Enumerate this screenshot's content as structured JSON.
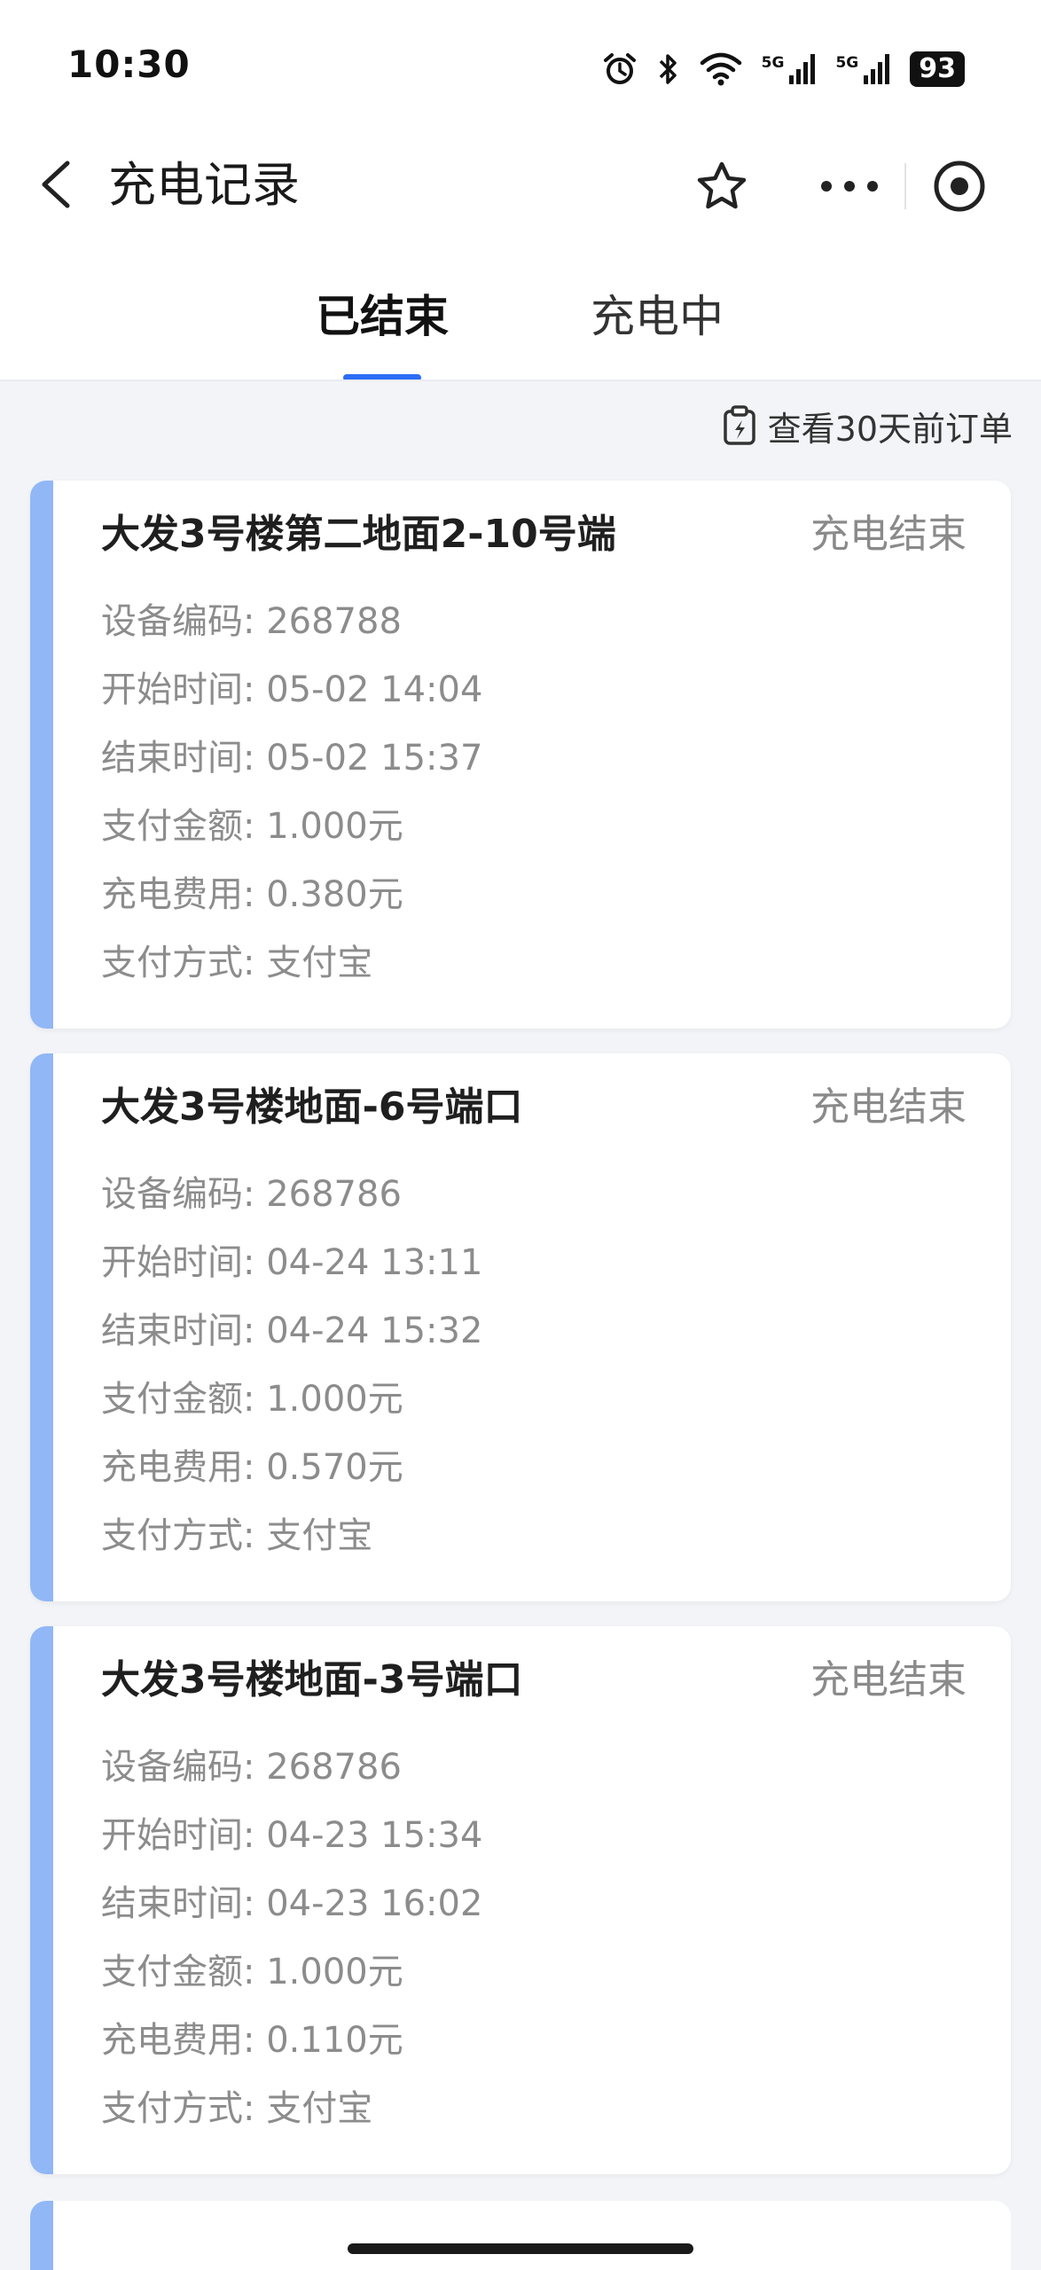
{
  "status_bar": {
    "time": "10:30",
    "signal_label_1": "5G",
    "signal_label_2": "5G",
    "battery": "93"
  },
  "nav": {
    "title": "充电记录"
  },
  "tabs": [
    {
      "label": "已结束",
      "active": true
    },
    {
      "label": "充电中",
      "active": false
    }
  ],
  "history_link": {
    "label": "查看30天前订单"
  },
  "colors": {
    "accent": "#2d6df6",
    "card_stripe": "#91b7f7",
    "muted_text": "#8c8c8c"
  },
  "records": [
    {
      "title": "大发3号楼第二地面2-10号端",
      "status": "充电结束",
      "device_label": "设备编码: ",
      "device": "268788",
      "start_label": "开始时间: ",
      "start": "05-02 14:04",
      "end_label": "结束时间: ",
      "end": "05-02 15:37",
      "paid_label": "支付金额: ",
      "paid": "1.000元",
      "fee_label": "充电费用: ",
      "fee": "0.380元",
      "method_label": "支付方式: ",
      "method": "支付宝"
    },
    {
      "title": "大发3号楼地面-6号端口",
      "status": "充电结束",
      "device_label": "设备编码: ",
      "device": "268786",
      "start_label": "开始时间: ",
      "start": "04-24 13:11",
      "end_label": "结束时间: ",
      "end": "04-24 15:32",
      "paid_label": "支付金额: ",
      "paid": "1.000元",
      "fee_label": "充电费用: ",
      "fee": "0.570元",
      "method_label": "支付方式: ",
      "method": "支付宝"
    },
    {
      "title": "大发3号楼地面-3号端口",
      "status": "充电结束",
      "device_label": "设备编码: ",
      "device": "268786",
      "start_label": "开始时间: ",
      "start": "04-23 15:34",
      "end_label": "结束时间: ",
      "end": "04-23 16:02",
      "paid_label": "支付金额: ",
      "paid": "1.000元",
      "fee_label": "充电费用: ",
      "fee": "0.110元",
      "method_label": "支付方式: ",
      "method": "支付宝"
    }
  ]
}
